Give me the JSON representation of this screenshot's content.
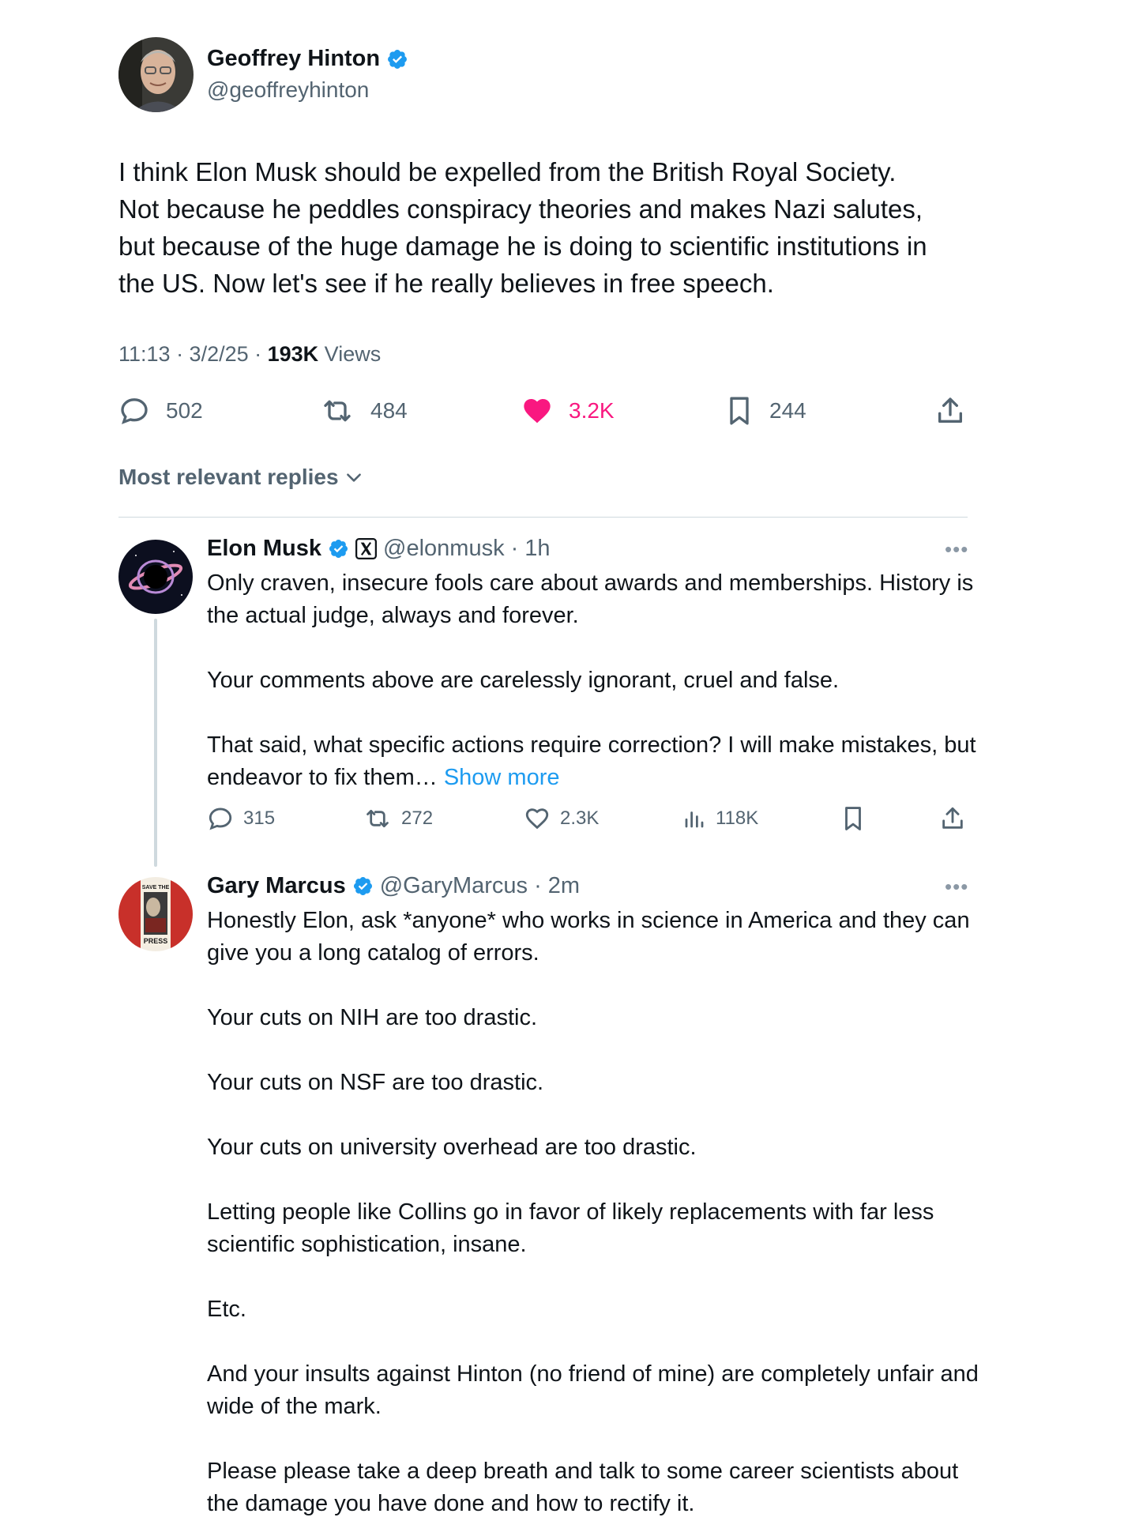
{
  "main_tweet": {
    "author_name": "Geoffrey Hinton",
    "author_handle": "@geoffreyhinton",
    "text": "I think Elon Musk should be expelled from the British Royal Society.\nNot because he peddles conspiracy theories and makes Nazi salutes,\nbut because of the huge damage he is doing to scientific institutions in\nthe US. Now let's see if he really believes in free speech.",
    "time": "11:13 · 3/2/25 · ",
    "views_count": "193K",
    "views_label": " Views",
    "stats": {
      "replies": "502",
      "reposts": "484",
      "likes": "3.2K",
      "bookmarks": "244"
    },
    "colors": {
      "like_active": "#f91880",
      "verified": "#1d9bf0",
      "muted": "#536471"
    }
  },
  "replies_sort": {
    "label": "Most relevant replies"
  },
  "replies": [
    {
      "author_name": "Elon Musk",
      "author_handle": "@elonmusk",
      "time": "· 1h",
      "paragraphs": [
        "Only craven, insecure fools care about awards and memberships. History is the actual judge, always and forever.",
        "Your comments above are carelessly ignorant, cruel and false.",
        "That said, what specific actions require correction? I will make mistakes, but endeavor to fix them… "
      ],
      "show_more": "Show more",
      "stats": {
        "replies": "315",
        "reposts": "272",
        "likes": "2.3K",
        "views": "118K"
      }
    },
    {
      "author_name": "Gary Marcus",
      "author_handle": "@GaryMarcus",
      "time": "· 2m",
      "avatar_text_top": "SAVE THE",
      "avatar_text_bottom": "PRESS",
      "paragraphs": [
        "Honestly Elon, ask *anyone* who works in science in America and they can give you a long catalog of errors.",
        "Your cuts on NIH are too drastic.",
        "Your cuts on NSF are too drastic.",
        "Your cuts on university overhead are too drastic.",
        "Letting people like Collins go in favor of likely replacements with far less scientific sophistication, insane.",
        "Etc.",
        "And your insults against Hinton (no friend of mine) are completely unfair and wide of the mark.",
        "Please please take a deep breath and talk to some career scientists about the damage you have done and how to rectify it."
      ]
    }
  ]
}
